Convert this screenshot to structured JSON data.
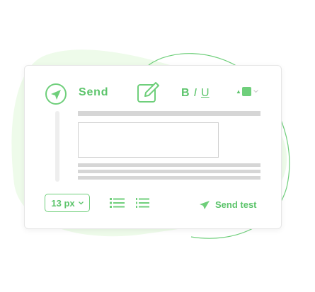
{
  "toolbar": {
    "send_label": "Send",
    "bold_label": "B",
    "italic_label": "I",
    "underline_label": "U"
  },
  "footer": {
    "font_size_value": "13 px",
    "send_test_label": "Send test"
  },
  "colors": {
    "accent": "#5cc46b",
    "accent_fill": "#6fcf7b",
    "blob": "#eefbea",
    "placeholder_line": "#d6d6d6"
  },
  "icons": [
    "paper-plane-icon",
    "edit-icon",
    "color-swatch-icon",
    "chevron-down-icon",
    "bullet-list-icon",
    "numbered-list-icon"
  ]
}
